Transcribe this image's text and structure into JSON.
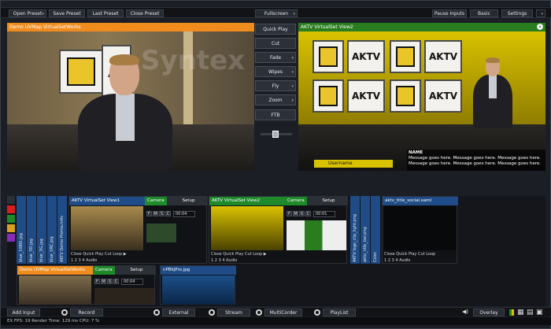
{
  "toolbar": {
    "open_preset": "Open Preset",
    "save_preset": "Save Preset",
    "last_preset": "Last Preset",
    "close_preset": "Close Preset",
    "fullscreen": "Fullscreen",
    "pause_inputs": "Pause Inputs",
    "basic": "Basic",
    "settings": "Settings"
  },
  "preview": {
    "title": "Demo UVMap VirtualSetWorks",
    "accent": "#f08c1e"
  },
  "output": {
    "title": "AKTV VirtualSet View2",
    "accent": "#2a7d1e",
    "sign_text": "AKTV",
    "lower_third_username": "Username",
    "ticker_name": "NAME",
    "ticker_message": "Message goes here. Message goes here. Message goes here. Message goes here. Message goes here. Message goes here."
  },
  "transitions": [
    "Quick Play",
    "Cut",
    "Fade",
    "Wipes",
    "Fly",
    "Zoom",
    "FTB"
  ],
  "watermark": "Syntex",
  "inputs": {
    "side_labels": [
      "blue_1080i.jpg",
      "blue_3D.jpg",
      "blue_3G.jpg",
      "blue_SRC.jpg",
      "AKTV Demo Promo.m4v"
    ],
    "input1": {
      "title": "AKTV VirtualSet View1",
      "camera": "Camera",
      "setup": "Setup",
      "time": "00:04",
      "controls": [
        "Close",
        "Quick Play",
        "Cut",
        "Loop"
      ],
      "numbers": [
        "1",
        "2",
        "3",
        "4",
        "Audio"
      ],
      "flags": [
        "F",
        "M",
        "S",
        "C"
      ]
    },
    "input2": {
      "title": "AKTV VirtualSet View2",
      "camera": "Camera",
      "setup": "Setup",
      "time": "00:01",
      "controls": [
        "Close",
        "Quick Play",
        "Cut",
        "Loop"
      ],
      "numbers": [
        "1",
        "2",
        "3",
        "4",
        "Audio"
      ],
      "flags": [
        "F",
        "M",
        "S",
        "C"
      ]
    },
    "mid_labels": [
      "AKTV logo_clip_light.png",
      "akto_title_bar.png",
      "Color"
    ],
    "input3": {
      "title": "aktv_title_social.xaml",
      "controls": [
        "Close",
        "Quick Play",
        "Cut",
        "Loop"
      ],
      "numbers": [
        "1",
        "2",
        "3",
        "4",
        "Audio"
      ]
    },
    "input4": {
      "title": "Demo UVMap VirtualSetWorks",
      "camera": "Camera",
      "setup": "Setup",
      "time": "00:04",
      "flags": [
        "F",
        "M",
        "S",
        "C"
      ]
    },
    "input5": {
      "title": "nPBkjPro.jpg"
    }
  },
  "bottombar": {
    "add_input": "Add Input",
    "record": "Record",
    "external": "External",
    "stream": "Stream",
    "multicorder": "MultiCorder",
    "playlist": "PlayList",
    "overlay": "Overlay"
  },
  "status": {
    "text": "EX  FPS: 19  Render Time: 129 ms  CPU: 7 %"
  }
}
